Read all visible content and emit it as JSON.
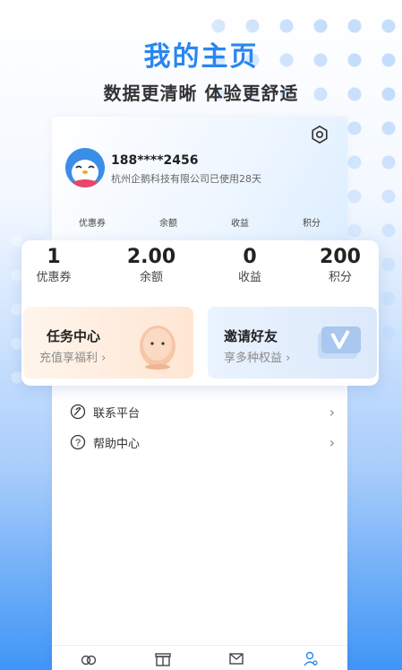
{
  "hero": {
    "title": "我的主页",
    "subtitle": "数据更清晰 体验更舒适"
  },
  "profile": {
    "phone": "188****2456",
    "company_status": "杭州企鹅科技有限公司已使用28天"
  },
  "mini_stats": [
    "优惠券",
    "余额",
    "收益",
    "积分"
  ],
  "stats": [
    {
      "value": "1",
      "label": "优惠券"
    },
    {
      "value": "2.00",
      "label": "余额"
    },
    {
      "value": "0",
      "label": "收益"
    },
    {
      "value": "200",
      "label": "积分"
    }
  ],
  "promos": {
    "task": {
      "title": "任务中心",
      "subtitle": "充值享福利 ›"
    },
    "invite": {
      "title": "邀请好友",
      "subtitle": "享多种权益 ›"
    }
  },
  "menu": [
    {
      "label": "联系平台",
      "icon": "leaf-icon"
    },
    {
      "label": "帮助中心",
      "icon": "question-icon"
    }
  ],
  "tabbar": [
    "home-icon",
    "gift-icon",
    "mail-icon",
    "profile-icon"
  ],
  "colors": {
    "accent": "#2a86f0",
    "avatar_bg": "#3b8ee8",
    "task_bg": "#ffe6d3",
    "invite_bg": "#dce9fb"
  }
}
